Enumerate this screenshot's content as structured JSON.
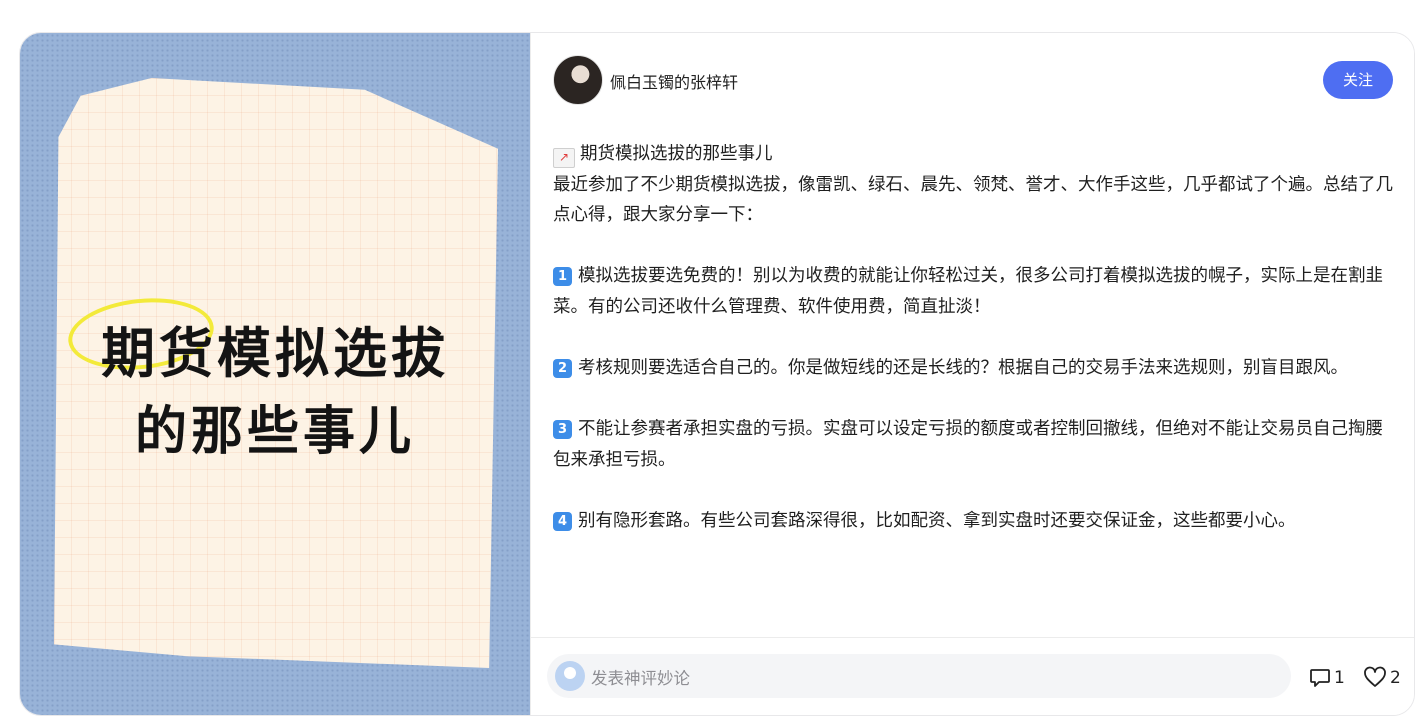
{
  "cover": {
    "title_line1": "期货模拟选拔",
    "title_line2": "的那些事儿"
  },
  "author": {
    "name": "佩白玉镯的张梓轩",
    "follow_label": "关注"
  },
  "post": {
    "heading": "期货模拟选拔的那些事儿",
    "intro": "最近参加了不少期货模拟选拔，像雷凯、绿石、晨先、领梵、誉才、大作手这些，几乎都试了个遍。总结了几点心得，跟大家分享一下：",
    "points": [
      {
        "num": "1",
        "text": "模拟选拔要选免费的！别以为收费的就能让你轻松过关，很多公司打着模拟选拔的幌子，实际上是在割韭菜。有的公司还收什么管理费、软件使用费，简直扯淡！"
      },
      {
        "num": "2",
        "text": "考核规则要选适合自己的。你是做短线的还是长线的？根据自己的交易手法来选规则，别盲目跟风。"
      },
      {
        "num": "3",
        "text": "不能让参赛者承担实盘的亏损。实盘可以设定亏损的额度或者控制回撤线，但绝对不能让交易员自己掏腰包来承担亏损。"
      },
      {
        "num": "4",
        "text": "别有隐形套路。有些公司套路深得很，比如配资、拿到实盘时还要交保证金，这些都要小心。"
      }
    ]
  },
  "footer": {
    "comment_placeholder": "发表神评妙论",
    "comment_count": "1",
    "like_count": "2"
  }
}
